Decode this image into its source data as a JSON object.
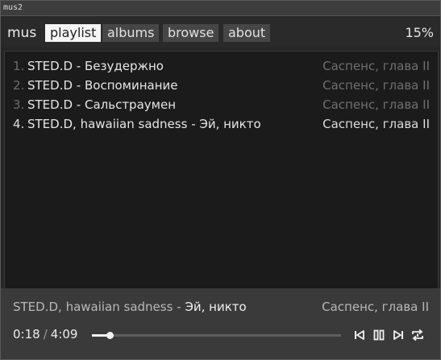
{
  "window": {
    "title": "mus2"
  },
  "nav": {
    "brand": "mus",
    "tabs": [
      {
        "label": "playlist",
        "active": true
      },
      {
        "label": "albums",
        "active": false
      },
      {
        "label": "browse",
        "active": false
      },
      {
        "label": "about",
        "active": false
      }
    ],
    "volume": "15%"
  },
  "playlist": [
    {
      "num": "1.",
      "title": "STED.D - Безудержно",
      "album": "Саспенс, глава II"
    },
    {
      "num": "2.",
      "title": "STED.D - Воспоминание",
      "album": "Саспенс, глава II"
    },
    {
      "num": "3.",
      "title": "STED.D - Сальстраумен",
      "album": "Саспенс, глава II"
    },
    {
      "num": "4.",
      "title": "STED.D, hawaiian sadness - Эй, никто",
      "album": "Саспенс, глава II"
    }
  ],
  "player": {
    "artist": "STED.D, hawaiian sadness - ",
    "song": "Эй, никто",
    "album": "Саспенс, глава II",
    "elapsed": "0:18",
    "separator": "/",
    "duration": "4:09",
    "progress": 0.072
  },
  "colors": {
    "accent": "#f5f5f5",
    "background": "#1b1b1b",
    "player_bg": "#3a3a3a"
  },
  "icons": {
    "prev": "skip-previous-icon",
    "pause": "pause-icon",
    "next": "skip-next-icon",
    "repeat": "repeat-icon"
  }
}
